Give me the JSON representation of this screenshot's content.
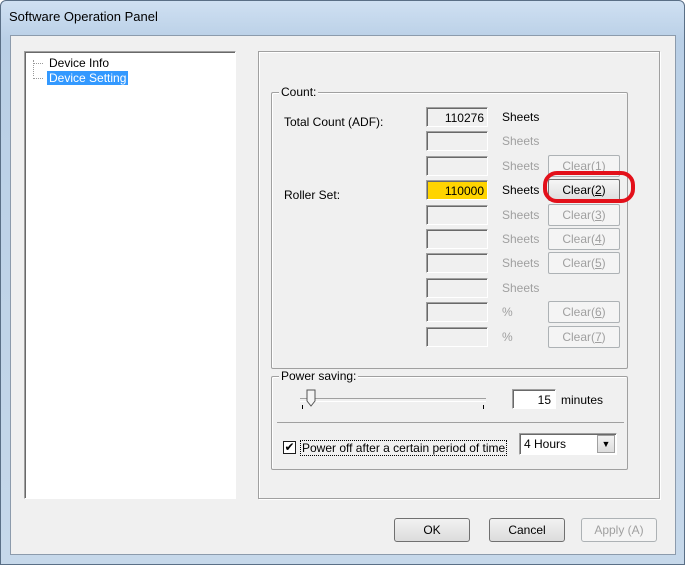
{
  "window": {
    "title": "Software Operation Panel"
  },
  "tree": {
    "items": [
      {
        "label": "Device Info",
        "selected": false
      },
      {
        "label": "Device Setting",
        "selected": true
      }
    ]
  },
  "count": {
    "group_label": "Count:",
    "total_count_label": "Total Count (ADF):",
    "roller_set_label": "Roller Set:",
    "rows": [
      {
        "value": "110276",
        "unit": "Sheets",
        "unit_enabled": true,
        "button": null
      },
      {
        "value": "",
        "unit": "Sheets",
        "unit_enabled": false,
        "button": null
      },
      {
        "value": "",
        "unit": "Sheets",
        "unit_enabled": false,
        "button": {
          "prefix": "Clear(",
          "key": "1",
          "suffix": ")",
          "enabled": false
        }
      },
      {
        "value": "110000",
        "unit": "Sheets",
        "unit_enabled": true,
        "highlight": true,
        "button": {
          "prefix": "Clear(",
          "key": "2",
          "suffix": ")",
          "enabled": true
        }
      },
      {
        "value": "",
        "unit": "Sheets",
        "unit_enabled": false,
        "button": {
          "prefix": "Clear(",
          "key": "3",
          "suffix": ")",
          "enabled": false
        }
      },
      {
        "value": "",
        "unit": "Sheets",
        "unit_enabled": false,
        "button": {
          "prefix": "Clear(",
          "key": "4",
          "suffix": ")",
          "enabled": false
        }
      },
      {
        "value": "",
        "unit": "Sheets",
        "unit_enabled": false,
        "button": {
          "prefix": "Clear(",
          "key": "5",
          "suffix": ")",
          "enabled": false
        }
      },
      {
        "value": "",
        "unit": "Sheets",
        "unit_enabled": false,
        "button": null
      },
      {
        "value": "",
        "unit": "%",
        "unit_enabled": false,
        "button": {
          "prefix": "Clear(",
          "key": "6",
          "suffix": ")",
          "enabled": false
        }
      },
      {
        "value": "",
        "unit": "%",
        "unit_enabled": false,
        "button": {
          "prefix": "Clear(",
          "key": "7",
          "suffix": ")",
          "enabled": false
        }
      }
    ]
  },
  "power_saving": {
    "group_label": "Power saving:",
    "value": "15",
    "unit": "minutes",
    "slider_level": 0.07,
    "power_off_label": "Power off after a certain period of time",
    "power_off_checked": true,
    "power_off_select": "4 Hours"
  },
  "footer": {
    "ok": "OK",
    "cancel": "Cancel",
    "apply": "Apply (A)"
  },
  "colors": {
    "highlight": "#ffd400",
    "selection": "#3399ff",
    "annotation": "#e3101a"
  }
}
